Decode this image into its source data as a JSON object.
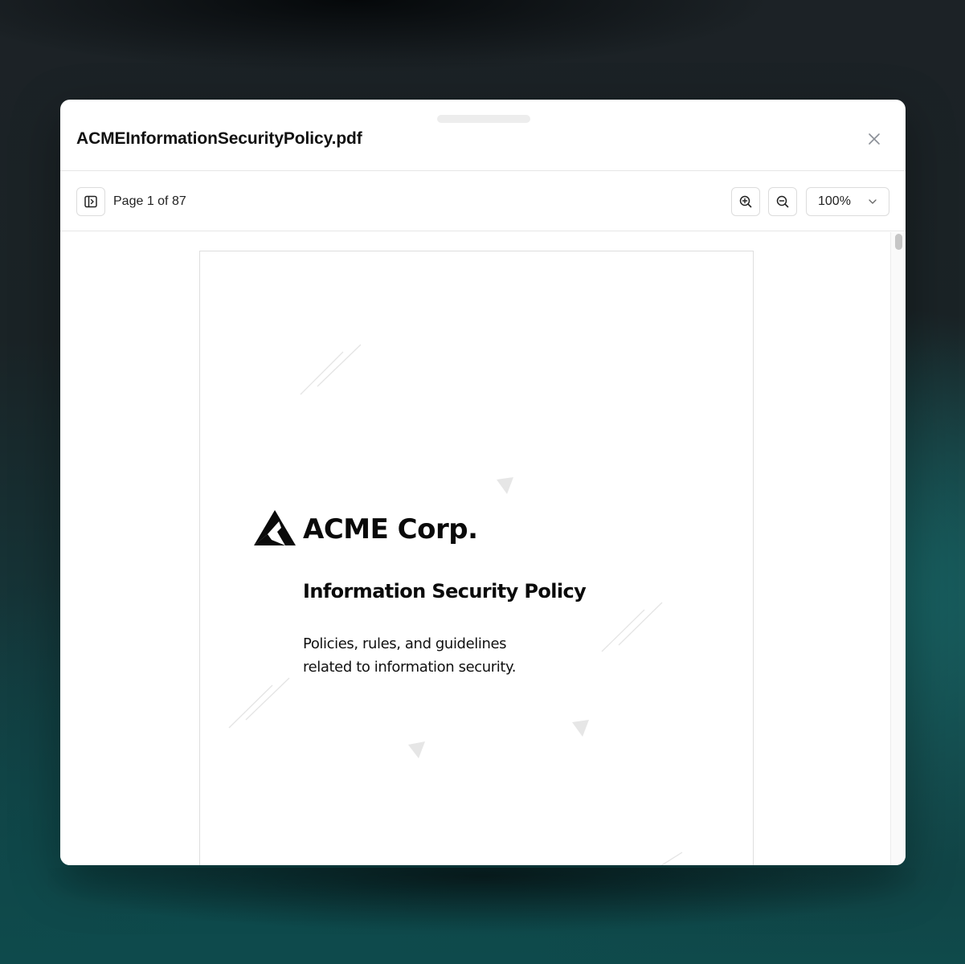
{
  "dialog": {
    "title": "ACMEInformationSecurityPolicy.pdf",
    "close_icon": "close-icon"
  },
  "toolbar": {
    "sidebar_icon": "sidebar-toggle-icon",
    "page_indicator": "Page 1 of 87",
    "zoom_in_icon": "zoom-in-icon",
    "zoom_out_icon": "zoom-out-icon",
    "zoom_level": "100%"
  },
  "document": {
    "logo_text": "ACME Corp.",
    "title": "Information Security Policy",
    "subtitle_line1": "Policies, rules, and guidelines",
    "subtitle_line2": "related to information security."
  }
}
